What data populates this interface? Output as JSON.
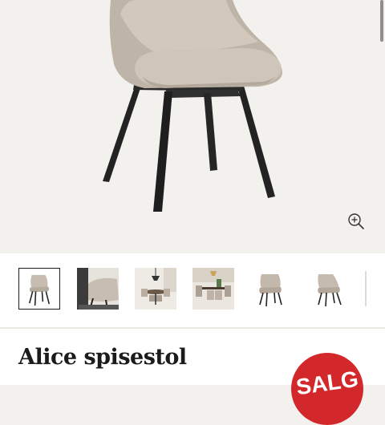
{
  "product": {
    "title": "Alice spisestol",
    "sale_badge": "SALG"
  },
  "gallery": {
    "zoom_icon": "zoom-in-icon",
    "thumbnails": [
      {
        "name": "thumbnail-1",
        "active": true
      },
      {
        "name": "thumbnail-2",
        "active": false
      },
      {
        "name": "thumbnail-3",
        "active": false
      },
      {
        "name": "thumbnail-4",
        "active": false
      },
      {
        "name": "thumbnail-5",
        "active": false
      },
      {
        "name": "thumbnail-6",
        "active": false
      },
      {
        "name": "thumbnail-7",
        "active": false
      }
    ]
  },
  "colors": {
    "sale": "#d3282b",
    "fabric": "#c9bfb3",
    "legs": "#222222",
    "background": "#f3f1ee"
  }
}
